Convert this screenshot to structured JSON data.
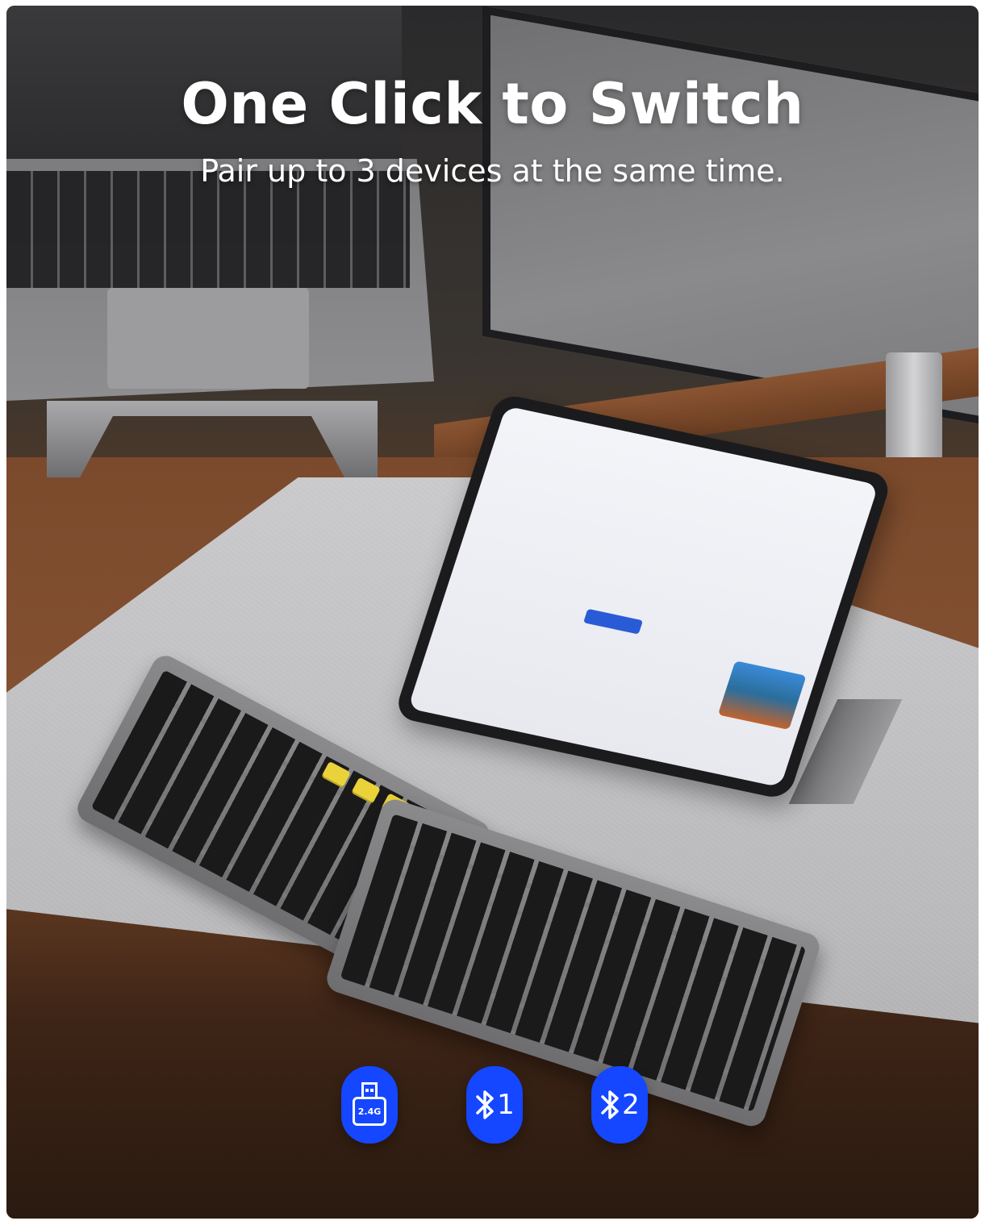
{
  "headline": {
    "title": "One Click to Switch",
    "subtitle": "Pair up to 3 devices at the same time."
  },
  "modes": [
    {
      "icon": "usb-receiver-icon",
      "label": "2.4G"
    },
    {
      "icon": "bluetooth-icon",
      "label": "1"
    },
    {
      "icon": "bluetooth-icon",
      "label": "2"
    }
  ],
  "colors": {
    "badge": "#1447ff",
    "accent_keys": "#e9d23a"
  }
}
